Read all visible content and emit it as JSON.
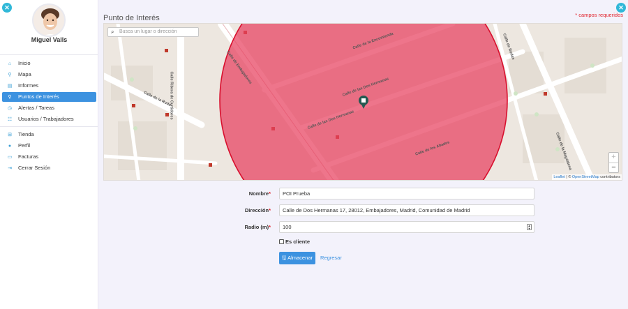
{
  "user": {
    "name": "Miguel Valls"
  },
  "nav": {
    "items": [
      {
        "label": "Inicio",
        "icon": "home-icon",
        "glyph": "⌂",
        "active": false
      },
      {
        "label": "Mapa",
        "icon": "map-pin-icon",
        "glyph": "⚲",
        "active": false
      },
      {
        "label": "Informes",
        "icon": "report-icon",
        "glyph": "▤",
        "active": false
      },
      {
        "label": "Puntos de Interés",
        "icon": "pin-icon",
        "glyph": "⚲",
        "active": true
      },
      {
        "label": "Alertas / Tareas",
        "icon": "alert-icon",
        "glyph": "◷",
        "active": false
      },
      {
        "label": "Usuarios / Trabajadores",
        "icon": "users-icon",
        "glyph": "☷",
        "active": false
      }
    ],
    "items2": [
      {
        "label": "Tienda",
        "icon": "store-icon",
        "glyph": "⊞",
        "active": false
      },
      {
        "label": "Perfil",
        "icon": "profile-icon",
        "glyph": "●",
        "active": false
      },
      {
        "label": "Facturas",
        "icon": "invoice-icon",
        "glyph": "▭",
        "active": false
      },
      {
        "label": "Cerrar Sesión",
        "icon": "logout-icon",
        "glyph": "⇥",
        "active": false
      }
    ]
  },
  "page": {
    "title": "Punto de Interés",
    "required_note": "* campos requeridos"
  },
  "map": {
    "search_placeholder": "Busca un lugar o dirección",
    "zoom_in": "+",
    "zoom_out": "−",
    "attribution_leaflet": "Leaflet",
    "attribution_sep": " | © ",
    "attribution_osm": "OpenStreetMap",
    "attribution_tail": " contributors",
    "streets": {
      "encomienda": "Calle de la Encomienda",
      "dos_hermanas": "Calle de las Dos Hermanas",
      "dos_hermanas_2": "Calle de las Dos Hermanas",
      "abades": "Calle de los Abades",
      "ruda": "Calle de la Ruda",
      "ribera": "Calle Ribera de Curtidores",
      "embajadores": "Calle de Embajadores",
      "magdalena": "Calle de la Magdalena",
      "rodas": "Calle de Rodas"
    },
    "circle_color": "#e8405e"
  },
  "form": {
    "nombre": {
      "label": "Nombre",
      "value": "POI Prueba"
    },
    "direccion": {
      "label": "Dirección",
      "value": "Calle de Dos Hermanas 17, 28012, Embajadores, Madrid, Comunidad de Madrid"
    },
    "radio": {
      "label": "Radio (m)",
      "value": "100"
    },
    "es_cliente": {
      "label": "Es cliente",
      "checked": false
    },
    "save_label": "Almacenar",
    "back_label": "Regresar"
  },
  "colors": {
    "accent": "#3c92e0",
    "required": "#e0222b",
    "teal": "#30b8d8"
  }
}
